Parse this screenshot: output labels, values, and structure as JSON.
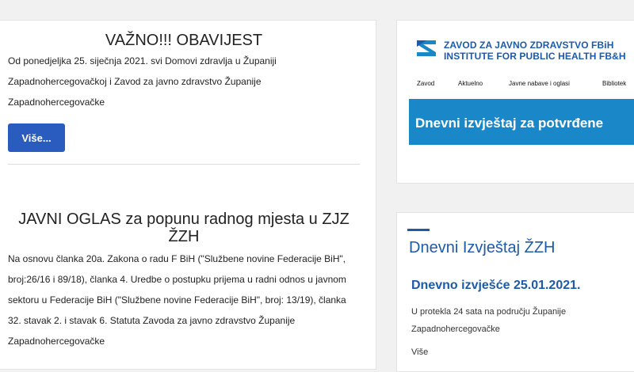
{
  "articles": [
    {
      "title": "VAŽNO!!! OBAVIJEST",
      "body": "Od ponedjeljka 25. siječnja 2021. svi Domovi zdravlja u Županiji Zapadnohercegovačkoj i Zavod za javno zdravstvo Županije Zapadnohercegovačke",
      "more_label": "Više..."
    },
    {
      "title": "JAVNI OGLAS za popunu radnog mjesta u ZJZ ŽZH",
      "body": "Na osnovu članka 20a. Zakona o radu F BiH (\"Službene novine Federacije BiH\", broj:26/16 i 89/18), članka 4. Uredbe o postupku prijema u radni odnos u javnom sektoru u Federacije BiH (\"Službene novine Federacije BiH\", broj: 13/19), članka 32. stavak 2. i stavak 6. Statuta Zavoda za javno zdravstvo Županije Zapadnohercegovačke"
    }
  ],
  "banner": {
    "logo_line1": "ZAVOD ZA JAVNO ZDRAVSTVO FBiH",
    "logo_line2": "INSTITUTE FOR PUBLIC HEALTH FB&H",
    "nav": [
      "Zavod",
      "Aktuelno",
      "Javne nabave i oglasi",
      "Bibliotek"
    ],
    "band_text": "Dnevni izvještaj za potvrđene",
    "brand_color": "#1d5aa8",
    "band_color": "#1a87c9",
    "logo_icon": "zzjz-logo-icon"
  },
  "report": {
    "heading": "Dnevni Izvještaj ŽZH",
    "subtitle": "Dnevno izvješće 25.01.2021.",
    "text": "U protekla 24 sata na području Županije Zapadnohercegovačke",
    "more_label": "Više"
  },
  "colors": {
    "button": "#2a5bbf",
    "link_blue": "#1d5aa8"
  }
}
